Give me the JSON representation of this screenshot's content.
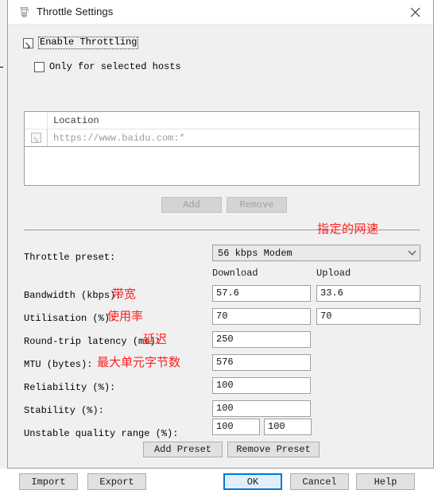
{
  "background_window": {
    "visible": true
  },
  "window": {
    "title": "Throttle Settings",
    "icon": "fiddler-jug-icon",
    "close_label": "✕",
    "accent_color": "#0078d7",
    "annotation_color": "#ff1f1f",
    "background_color": "#f0f0f0"
  },
  "options": {
    "enable_throttling": {
      "label": "Enable Throttling",
      "checked": true,
      "focused": true
    },
    "only_selected_hosts": {
      "label": "Only for selected hosts",
      "checked": false
    }
  },
  "hosts_list": {
    "columns": [
      "",
      "Location"
    ],
    "rows": [
      {
        "checked": true,
        "enabled": false,
        "location": "https://www.baidu.com:*"
      }
    ]
  },
  "list_buttons": {
    "add": {
      "label": "Add",
      "disabled": true
    },
    "remove": {
      "label": "Remove",
      "disabled": true
    }
  },
  "annotations": {
    "speed": "指定的网速",
    "bandwidth": "带宽",
    "utilisation": "使用率",
    "latency": "延迟",
    "mtu": "最大单元字节数"
  },
  "preset": {
    "label": "Throttle preset:",
    "selected": "56 kbps Modem",
    "arrow_icon": "chevron-down-icon"
  },
  "column_headers": {
    "download": "Download",
    "upload": "Upload"
  },
  "fields": {
    "bandwidth": {
      "label": "Bandwidth (kbps):",
      "download": "57.6",
      "upload": "33.6"
    },
    "utilisation": {
      "label": "Utilisation (%):",
      "download": "70",
      "upload": "70"
    },
    "latency": {
      "label": "Round-trip latency (ms):",
      "value": "250"
    },
    "mtu": {
      "label": "MTU (bytes):",
      "value": "576"
    },
    "reliability": {
      "label": "Reliability (%):",
      "value": "100"
    },
    "stability": {
      "label": "Stability (%):",
      "value": "100"
    },
    "unstable_quality_range": {
      "label": "Unstable quality range (%):",
      "min": "100",
      "max": "100"
    }
  },
  "preset_buttons": {
    "add_preset": "Add Preset",
    "remove_preset": "Remove Preset"
  },
  "footer_buttons": {
    "import": "Import",
    "export": "Export",
    "ok": "OK",
    "cancel": "Cancel",
    "help": "Help"
  }
}
